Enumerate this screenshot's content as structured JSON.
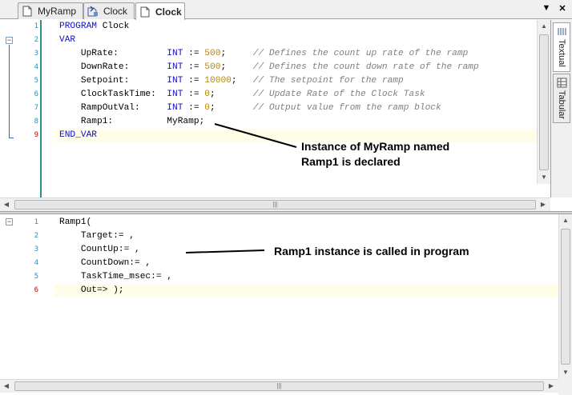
{
  "tabs": [
    {
      "label": "MyRamp",
      "icon": "document-icon",
      "active": false
    },
    {
      "label": "Clock",
      "icon": "program-icon",
      "active": false
    },
    {
      "label": "Clock",
      "icon": "document-icon",
      "active": true
    }
  ],
  "tab_controls": {
    "dropdown": "▼",
    "close": "✕"
  },
  "side_tabs": [
    {
      "label": "Textual",
      "icon": "textual-icon",
      "active": true
    },
    {
      "label": "Tabular",
      "icon": "tabular-icon",
      "active": false
    }
  ],
  "declaration": {
    "line_numbers": [
      "1",
      "2",
      "3",
      "4",
      "5",
      "6",
      "7",
      "8",
      "9"
    ],
    "lines": [
      [
        {
          "t": "PROGRAM",
          "c": "kw"
        },
        {
          "t": " Clock",
          "c": ""
        }
      ],
      [
        {
          "t": "VAR",
          "c": "kw"
        }
      ],
      [
        {
          "t": "    UpRate:         ",
          "c": ""
        },
        {
          "t": "INT",
          "c": "kw"
        },
        {
          "t": " := ",
          "c": ""
        },
        {
          "t": "500",
          "c": "num"
        },
        {
          "t": ";     ",
          "c": ""
        },
        {
          "t": "// Defines the count up rate of the ramp",
          "c": "cmt"
        }
      ],
      [
        {
          "t": "    DownRate:       ",
          "c": ""
        },
        {
          "t": "INT",
          "c": "kw"
        },
        {
          "t": " := ",
          "c": ""
        },
        {
          "t": "500",
          "c": "num"
        },
        {
          "t": ";     ",
          "c": ""
        },
        {
          "t": "// Defines the count down rate of the ramp",
          "c": "cmt"
        }
      ],
      [
        {
          "t": "    Setpoint:       ",
          "c": ""
        },
        {
          "t": "INT",
          "c": "kw"
        },
        {
          "t": " := ",
          "c": ""
        },
        {
          "t": "10000",
          "c": "num"
        },
        {
          "t": ";   ",
          "c": ""
        },
        {
          "t": "// The setpoint for the ramp",
          "c": "cmt"
        }
      ],
      [
        {
          "t": "    ClockTaskTime:  ",
          "c": ""
        },
        {
          "t": "INT",
          "c": "kw"
        },
        {
          "t": " := ",
          "c": ""
        },
        {
          "t": "0",
          "c": "num"
        },
        {
          "t": ";       ",
          "c": ""
        },
        {
          "t": "// Update Rate of the Clock Task",
          "c": "cmt"
        }
      ],
      [
        {
          "t": "    RampOutVal:     ",
          "c": ""
        },
        {
          "t": "INT",
          "c": "kw"
        },
        {
          "t": " := ",
          "c": ""
        },
        {
          "t": "0",
          "c": "num"
        },
        {
          "t": ";       ",
          "c": ""
        },
        {
          "t": "// Output value from the ramp block",
          "c": "cmt"
        }
      ],
      [
        {
          "t": "    Ramp1:          MyRamp;",
          "c": ""
        }
      ],
      [
        {
          "t": "END_VAR",
          "c": "kw"
        }
      ]
    ]
  },
  "implementation": {
    "line_numbers": [
      "1",
      "2",
      "3",
      "4",
      "5",
      "6"
    ],
    "lines": [
      [
        {
          "t": "Ramp1(",
          "c": ""
        }
      ],
      [
        {
          "t": "    Target:= ,",
          "c": ""
        }
      ],
      [
        {
          "t": "    CountUp:= ,",
          "c": ""
        }
      ],
      [
        {
          "t": "    CountDown:= ,",
          "c": ""
        }
      ],
      [
        {
          "t": "    TaskTime_msec:= ,",
          "c": ""
        }
      ],
      [
        {
          "t": "    Out=> );",
          "c": ""
        }
      ]
    ]
  },
  "annotations": {
    "instance_line1": "Instance of MyRamp named",
    "instance_line2": "Ramp1 is declared",
    "call_note": "Ramp1 instance is called in program"
  },
  "colors": {
    "keyword": "#1010c8",
    "number": "#b8860b",
    "comment": "#808080",
    "line_number": "#2b91af",
    "error_line": "#cc0000",
    "highlight": "#fffde8"
  }
}
